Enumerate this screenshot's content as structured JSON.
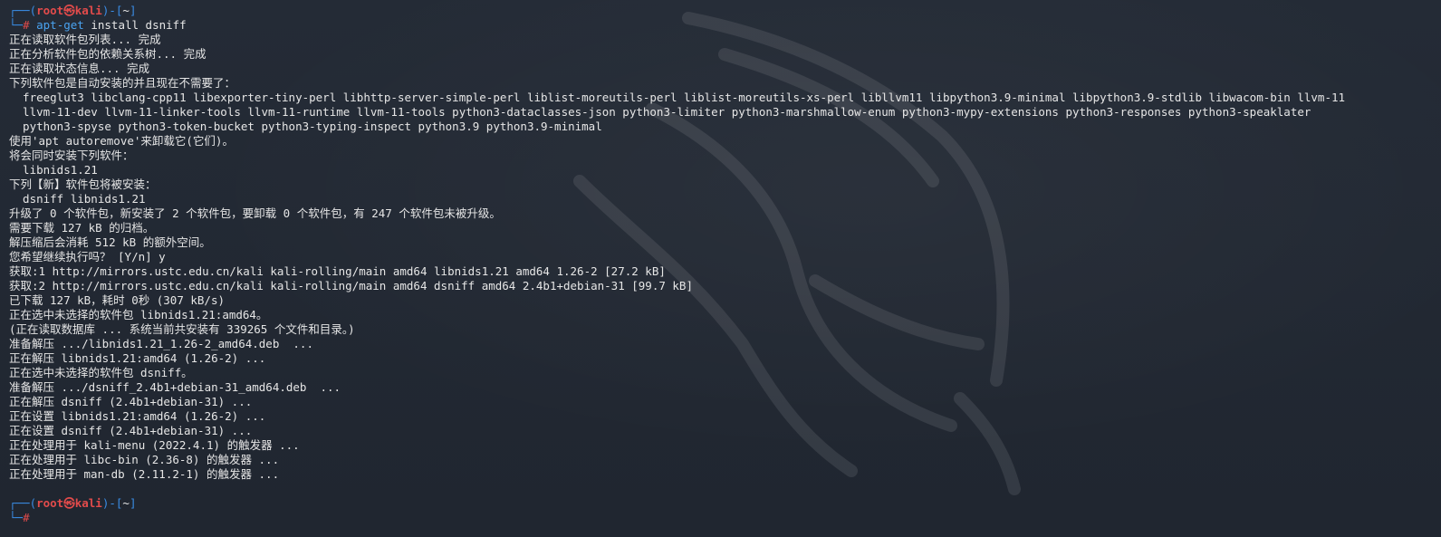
{
  "prompt": {
    "top_open": "┌──(",
    "user": "root",
    "at": "㉿",
    "host": "kali",
    "mid": ")-[",
    "path": "~",
    "close": "]",
    "bottom": "└─",
    "symbol": "#"
  },
  "command": {
    "name": "apt-get",
    "args": " install dsniff"
  },
  "output": [
    "正在读取软件包列表... 完成",
    "正在分析软件包的依赖关系树... 完成",
    "正在读取状态信息... 完成",
    "下列软件包是自动安装的并且现在不需要了：",
    "  freeglut3 libclang-cpp11 libexporter-tiny-perl libhttp-server-simple-perl liblist-moreutils-perl liblist-moreutils-xs-perl libllvm11 libpython3.9-minimal libpython3.9-stdlib libwacom-bin llvm-11",
    "  llvm-11-dev llvm-11-linker-tools llvm-11-runtime llvm-11-tools python3-dataclasses-json python3-limiter python3-marshmallow-enum python3-mypy-extensions python3-responses python3-speaklater",
    "  python3-spyse python3-token-bucket python3-typing-inspect python3.9 python3.9-minimal",
    "使用'apt autoremove'来卸载它(它们)。",
    "将会同时安装下列软件：",
    "  libnids1.21",
    "下列【新】软件包将被安装：",
    "  dsniff libnids1.21",
    "升级了 0 个软件包，新安装了 2 个软件包，要卸载 0 个软件包，有 247 个软件包未被升级。",
    "需要下载 127 kB 的归档。",
    "解压缩后会消耗 512 kB 的额外空间。",
    "您希望继续执行吗？ [Y/n] y",
    "获取:1 http://mirrors.ustc.edu.cn/kali kali-rolling/main amd64 libnids1.21 amd64 1.26-2 [27.2 kB]",
    "获取:2 http://mirrors.ustc.edu.cn/kali kali-rolling/main amd64 dsniff amd64 2.4b1+debian-31 [99.7 kB]",
    "已下载 127 kB，耗时 0秒 (307 kB/s)",
    "正在选中未选择的软件包 libnids1.21:amd64。",
    "(正在读取数据库 ... 系统当前共安装有 339265 个文件和目录。)",
    "准备解压 .../libnids1.21_1.26-2_amd64.deb  ...",
    "正在解压 libnids1.21:amd64 (1.26-2) ...",
    "正在选中未选择的软件包 dsniff。",
    "准备解压 .../dsniff_2.4b1+debian-31_amd64.deb  ...",
    "正在解压 dsniff (2.4b1+debian-31) ...",
    "正在设置 libnids1.21:amd64 (1.26-2) ...",
    "正在设置 dsniff (2.4b1+debian-31) ...",
    "正在处理用于 kali-menu (2022.4.1) 的触发器 ...",
    "正在处理用于 libc-bin (2.36-8) 的触发器 ...",
    "正在处理用于 man-db (2.11.2-1) 的触发器 ..."
  ],
  "colors": {
    "background": "#232a35",
    "text": "#e6e6e6",
    "frame": "#3a8de6",
    "user": "#e24b4b",
    "command": "#4aa3f0"
  }
}
